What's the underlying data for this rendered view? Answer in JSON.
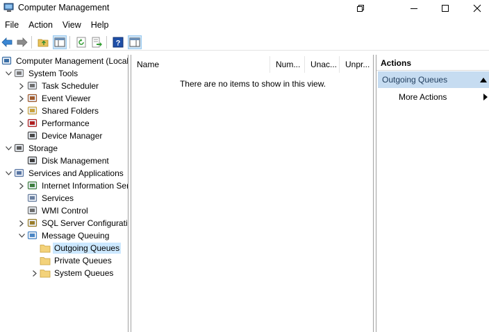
{
  "window": {
    "title": "Computer Management",
    "controls": {
      "restore": "restore-icon",
      "minimize": "minimize-icon",
      "maximize": "maximize-icon",
      "close": "close-icon"
    }
  },
  "menu": [
    "File",
    "Action",
    "View",
    "Help"
  ],
  "toolbar": [
    "back-icon",
    "forward-icon",
    "up-folder-icon",
    "show-hide-tree-icon",
    "refresh-icon",
    "export-list-icon",
    "help-icon",
    "show-hide-action-pane-icon"
  ],
  "tree": [
    {
      "label": "Computer Management (Local",
      "icon": "computer-management-icon",
      "level": 0,
      "expander": ""
    },
    {
      "label": "System Tools",
      "icon": "system-tools-icon",
      "level": 1,
      "expander": "expanded"
    },
    {
      "label": "Task Scheduler",
      "icon": "task-scheduler-icon",
      "level": 2,
      "expander": "collapsed"
    },
    {
      "label": "Event Viewer",
      "icon": "event-viewer-icon",
      "level": 2,
      "expander": "collapsed"
    },
    {
      "label": "Shared Folders",
      "icon": "shared-folders-icon",
      "level": 2,
      "expander": "collapsed"
    },
    {
      "label": "Performance",
      "icon": "performance-icon",
      "level": 2,
      "expander": "collapsed"
    },
    {
      "label": "Device Manager",
      "icon": "device-manager-icon",
      "level": 2,
      "expander": ""
    },
    {
      "label": "Storage",
      "icon": "storage-icon",
      "level": 1,
      "expander": "expanded"
    },
    {
      "label": "Disk Management",
      "icon": "disk-management-icon",
      "level": 2,
      "expander": ""
    },
    {
      "label": "Services and Applications",
      "icon": "services-applications-icon",
      "level": 1,
      "expander": "expanded"
    },
    {
      "label": "Internet Information Ser",
      "icon": "iis-icon",
      "level": 2,
      "expander": "collapsed"
    },
    {
      "label": "Services",
      "icon": "services-icon",
      "level": 2,
      "expander": ""
    },
    {
      "label": "WMI Control",
      "icon": "wmi-control-icon",
      "level": 2,
      "expander": ""
    },
    {
      "label": "SQL Server Configuratic",
      "icon": "sql-server-config-icon",
      "level": 2,
      "expander": "collapsed"
    },
    {
      "label": "Message Queuing",
      "icon": "message-queuing-icon",
      "level": 2,
      "expander": "expanded"
    },
    {
      "label": "Outgoing Queues",
      "icon": "folder-icon",
      "level": 3,
      "expander": "",
      "selected": true
    },
    {
      "label": "Private Queues",
      "icon": "folder-icon",
      "level": 3,
      "expander": ""
    },
    {
      "label": "System Queues",
      "icon": "folder-icon",
      "level": 3,
      "expander": "collapsed"
    }
  ],
  "list": {
    "columns": [
      "Name",
      "Num...",
      "Unac...",
      "Unpr..."
    ],
    "empty_message": "There are no items to show in this view."
  },
  "actions": {
    "header": "Actions",
    "section": "Outgoing Queues",
    "items": [
      "More Actions"
    ]
  },
  "colors": {
    "selection": "#cce8ff",
    "actions_section": "#c6dcf1"
  }
}
